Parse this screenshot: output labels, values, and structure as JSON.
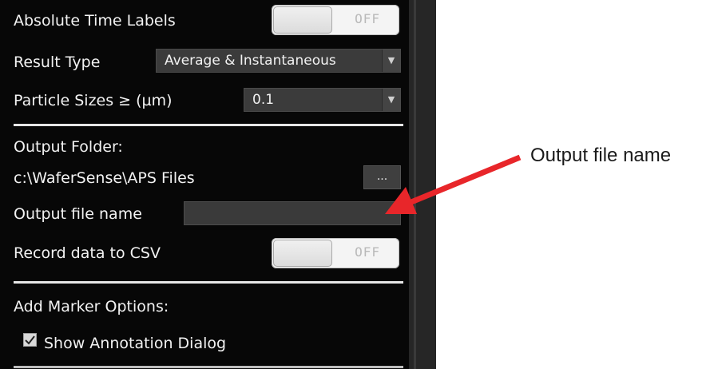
{
  "settings": {
    "absolute_time_labels": {
      "label": "Absolute Time Labels",
      "state": "OFF"
    },
    "result_type": {
      "label": "Result Type",
      "value": "Average & Instantaneous"
    },
    "particle_sizes": {
      "label": "Particle Sizes ≥ (µm)",
      "value": "0.1"
    },
    "output_folder": {
      "label": "Output Folder:",
      "path": "c:\\WaferSense\\APS Files",
      "browse_label": "..."
    },
    "output_file_name": {
      "label": "Output file name",
      "value": ""
    },
    "record_csv": {
      "label": "Record data to CSV",
      "state": "OFF"
    },
    "marker_options": {
      "label": "Add Marker Options:"
    },
    "show_annotation": {
      "label": "Show Annotation Dialog",
      "checked": true
    }
  },
  "annotation": {
    "text": "Output file name",
    "arrow_color": "#e8262a"
  },
  "colors": {
    "panel_bg": "#070707",
    "control_bg": "#3b3b3b"
  }
}
